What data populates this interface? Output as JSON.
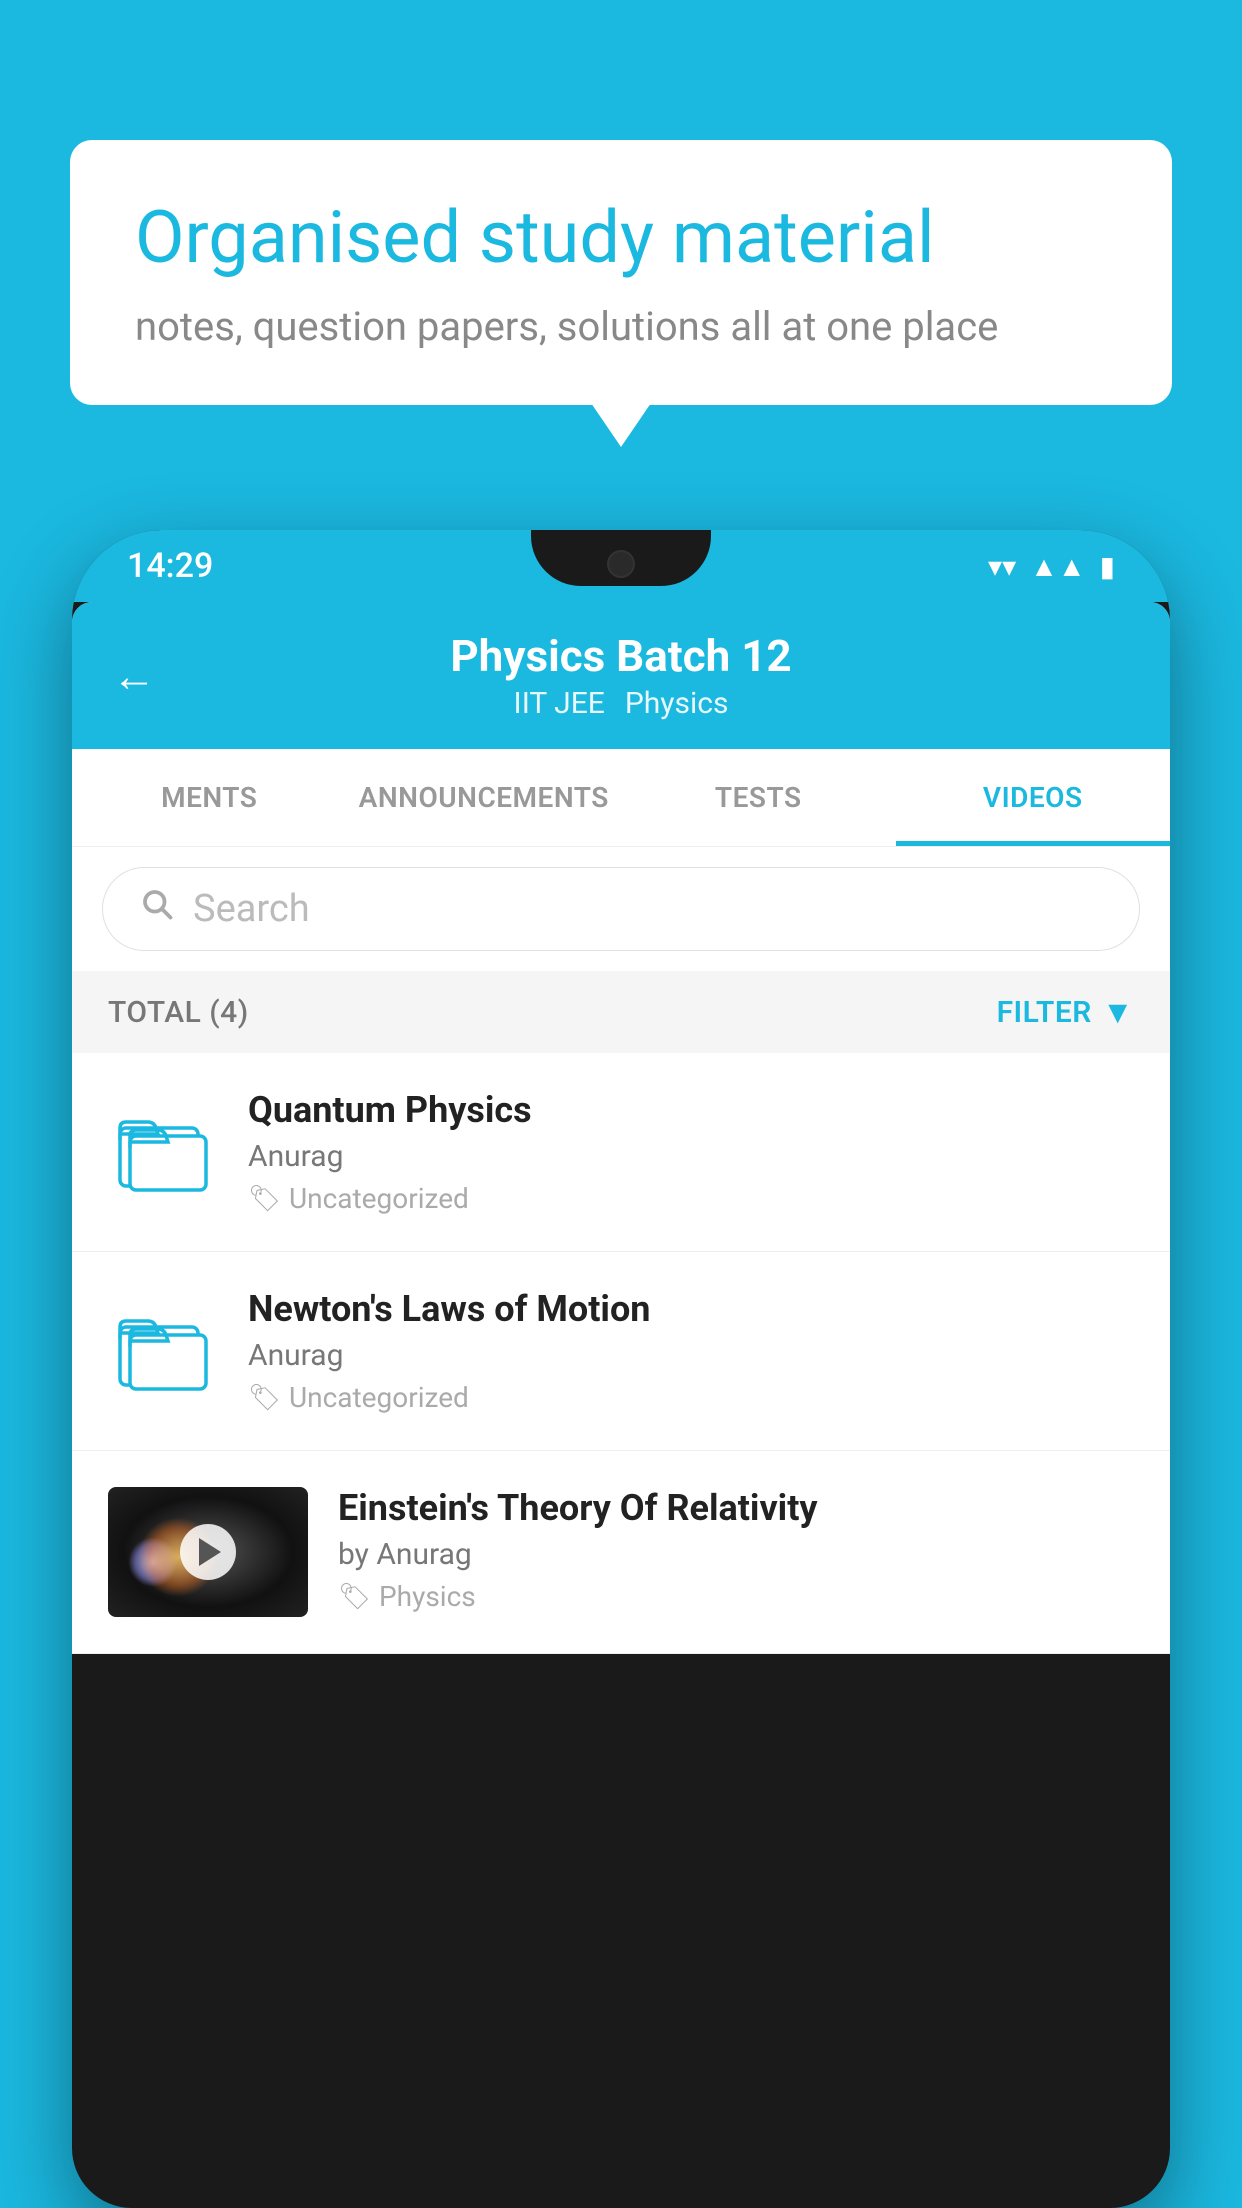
{
  "background": {
    "color": "#1bb8e0"
  },
  "speech_bubble": {
    "title": "Organised study material",
    "subtitle": "notes, question papers, solutions all at one place"
  },
  "phone": {
    "status_bar": {
      "time": "14:29"
    },
    "header": {
      "title": "Physics Batch 12",
      "subtitle1": "IIT JEE",
      "subtitle2": "Physics",
      "back_label": "←"
    },
    "tabs": [
      {
        "label": "MENTS",
        "active": false
      },
      {
        "label": "ANNOUNCEMENTS",
        "active": false
      },
      {
        "label": "TESTS",
        "active": false
      },
      {
        "label": "VIDEOS",
        "active": true
      }
    ],
    "search": {
      "placeholder": "Search"
    },
    "filter_bar": {
      "total": "TOTAL (4)",
      "filter_label": "FILTER"
    },
    "videos": [
      {
        "title": "Quantum Physics",
        "author": "Anurag",
        "tag": "Uncategorized",
        "type": "folder"
      },
      {
        "title": "Newton's Laws of Motion",
        "author": "Anurag",
        "tag": "Uncategorized",
        "type": "folder"
      },
      {
        "title": "Einstein's Theory Of Relativity",
        "author": "by Anurag",
        "tag": "Physics",
        "type": "video"
      }
    ]
  }
}
